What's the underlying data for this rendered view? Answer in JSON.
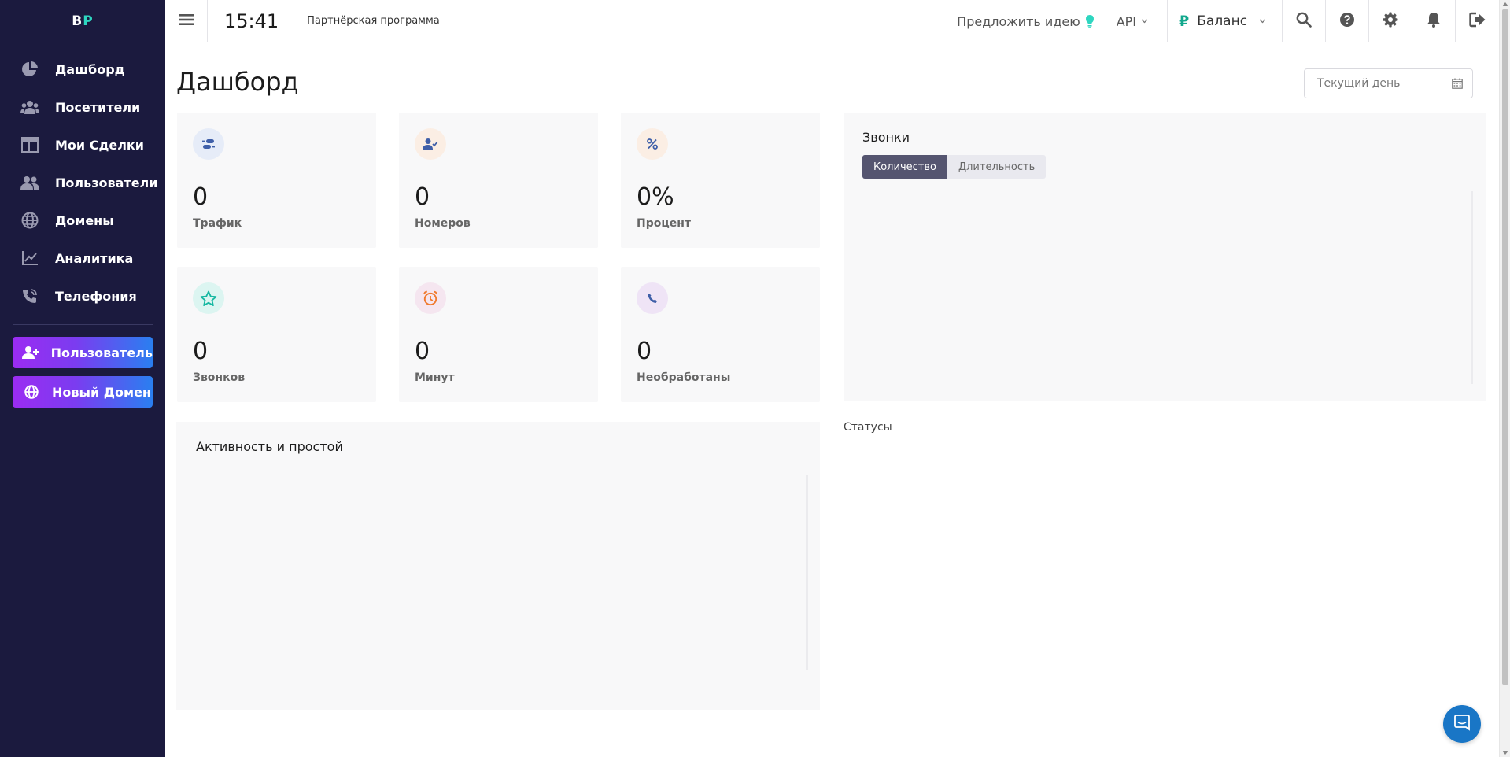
{
  "logo": {
    "part1": "B",
    "part2": "P"
  },
  "sidebar": {
    "items": [
      {
        "label": "Дашборд",
        "icon": "pie-chart-icon"
      },
      {
        "label": "Посетители",
        "icon": "users-icon"
      },
      {
        "label": "Мои Сделки",
        "icon": "table-icon"
      },
      {
        "label": "Пользователи",
        "icon": "user-group-icon"
      },
      {
        "label": "Домены",
        "icon": "globe-icon"
      },
      {
        "label": "Аналитика",
        "icon": "chart-line-icon"
      },
      {
        "label": "Телефония",
        "icon": "phone-icon"
      }
    ],
    "cta": [
      {
        "label": "Пользователь",
        "icon": "user-plus-icon"
      },
      {
        "label": "Новый Домен",
        "icon": "globe-icon"
      }
    ]
  },
  "topbar": {
    "time": "15:41",
    "partner": "Партнёрская программа",
    "idea": "Предложить идею",
    "api": "API",
    "balance_symbol": "₽",
    "balance": "Баланс",
    "icons": [
      "search-icon",
      "help-icon",
      "gear-icon",
      "bell-icon",
      "logout-icon"
    ]
  },
  "main": {
    "title": "Дашборд",
    "date_placeholder": "Текущий день",
    "cards": [
      {
        "value": "0",
        "label": "Трафик",
        "icon": "traffic-icon"
      },
      {
        "value": "0",
        "label": "Номеров",
        "icon": "user-check-icon"
      },
      {
        "value": "0%",
        "label": "Процент",
        "icon": "percent-icon"
      },
      {
        "value": "0",
        "label": "Звонков",
        "icon": "star-icon"
      },
      {
        "value": "0",
        "label": "Минут",
        "icon": "alarm-clock-icon"
      },
      {
        "value": "0",
        "label": "Необработаны",
        "icon": "phone-icon"
      }
    ],
    "calls": {
      "title": "Звонки",
      "tabs": [
        "Количество",
        "Длительность"
      ]
    },
    "activity": {
      "title": "Активность и простой"
    },
    "statuses": "Статусы"
  },
  "colors": {
    "sidebar_bg": "#1b1a3e",
    "accent_teal": "#2ed6c0",
    "cta_gradient_start": "#9b2cf2",
    "cta_gradient_end": "#2a7ff0",
    "chat_button": "#1976c6"
  }
}
